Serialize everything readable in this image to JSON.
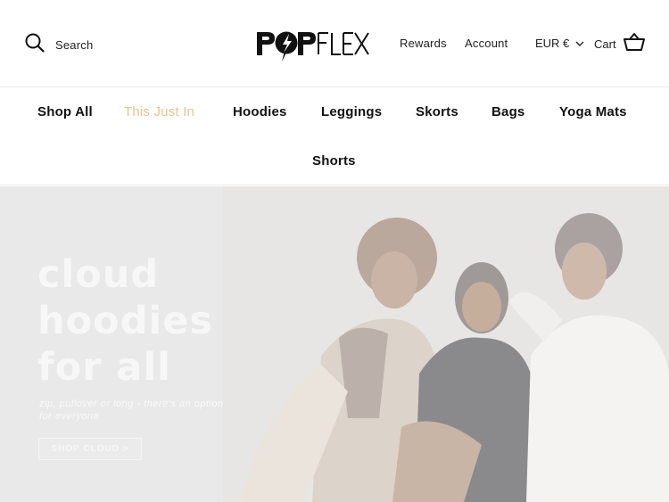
{
  "header": {
    "search_label": "Search",
    "brand": "POPFLEX",
    "rewards_label": "Rewards",
    "account_label": "Account",
    "currency_label": "EUR €",
    "cart_label": "Cart"
  },
  "nav": {
    "items": [
      {
        "label": "Shop All"
      },
      {
        "label": "This Just In",
        "active": true
      },
      {
        "label": "Hoodies"
      },
      {
        "label": "Leggings"
      },
      {
        "label": "Skorts"
      },
      {
        "label": "Bags"
      },
      {
        "label": "Yoga Mats"
      },
      {
        "label": "Shorts"
      }
    ]
  },
  "hero": {
    "title_lines": [
      "cloud",
      "hoodies",
      "for all"
    ],
    "subtitle": "zip, pullover or long - there's an option for everyone",
    "cta_label": "SHOP CLOUD >"
  },
  "colors": {
    "accent_nav_active": "#f0c08e",
    "hero_background": "#e9e9e9",
    "text": "#111111"
  },
  "icons": [
    "search-icon",
    "chevron-down-icon",
    "cart-basket-icon",
    "popflex-logo"
  ]
}
